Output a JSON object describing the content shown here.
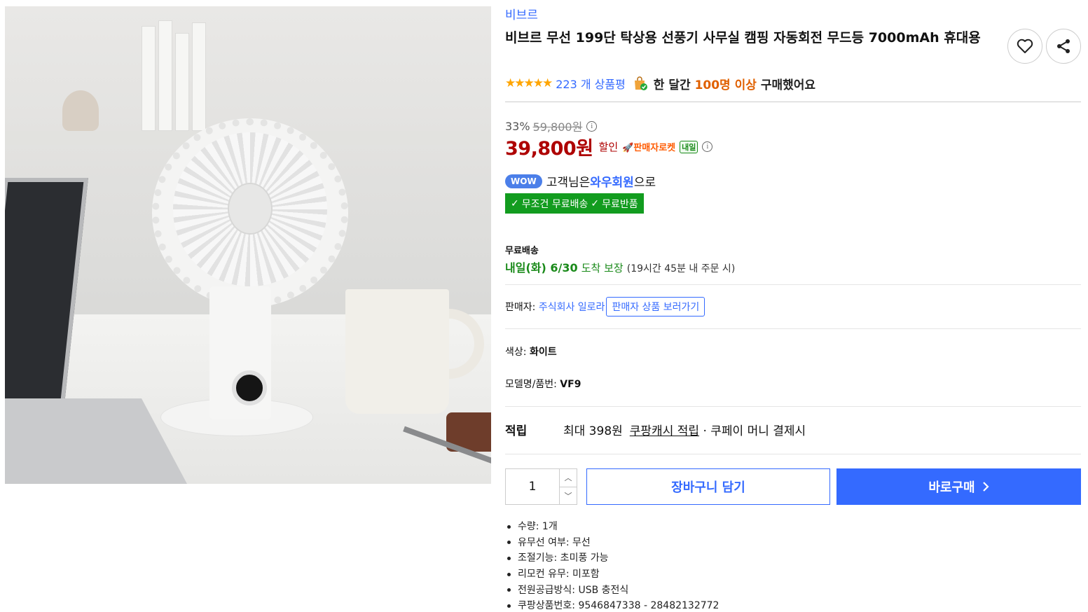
{
  "product": {
    "brand": "비브르",
    "title": "비브르 무선 199단 탁상용 선풍기 사무실 캠핑 자동회전 무드등 7000mAh 휴대용",
    "rating_stars": "★★★★★",
    "review_count": "223 개 상품평",
    "bought_prefix": "한 달간",
    "bought_highlight": "100명 이상",
    "bought_suffix": "구매했어요"
  },
  "price": {
    "discount_rate": "33%",
    "original_price": "59,800원",
    "sale_price": "39,800원",
    "sale_label": "할인",
    "delivery_badge": "🚀판매자로켓",
    "tomorrow_badge": "내일"
  },
  "wow": {
    "badge": "WOW",
    "text_prefix": "고객님은",
    "member": "와우회원",
    "text_suffix": "으로",
    "benefit_1": "무조건 무료배송",
    "benefit_2": "무료반품"
  },
  "shipping": {
    "label": "무료배송",
    "date": "내일(화) 6/30",
    "guarantee": "도착 보장",
    "note": "(19시간 45분 내 주문 시)"
  },
  "seller": {
    "label": "판매자:",
    "name": "주식회사 일로라",
    "link": "판매자 상품 보러가기"
  },
  "options": {
    "color_label": "색상:",
    "color_value": "화이트",
    "model_label": "모델명/품번:",
    "model_value": "VF9"
  },
  "points": {
    "label": "적립",
    "max_text": "최대 398원",
    "cash_link": "쿠팡캐시 적립",
    "suffix": "· 쿠페이 머니 결제시"
  },
  "purchase": {
    "quantity": "1",
    "cart_label": "장바구니 담기",
    "buy_label": "바로구매"
  },
  "specs": [
    "수량: 1개",
    "유무선 여부: 무선",
    "조절기능: 초미풍 가능",
    "리모컨 유무: 미포함",
    "전원공급방식: USB 충전식",
    "쿠팡상품번호: 9546847338 - 28482132772"
  ],
  "colors": {
    "accent": "#346aff",
    "price_red": "#ae0000",
    "wow_green": "#129c1f",
    "star": "#ffa500"
  }
}
